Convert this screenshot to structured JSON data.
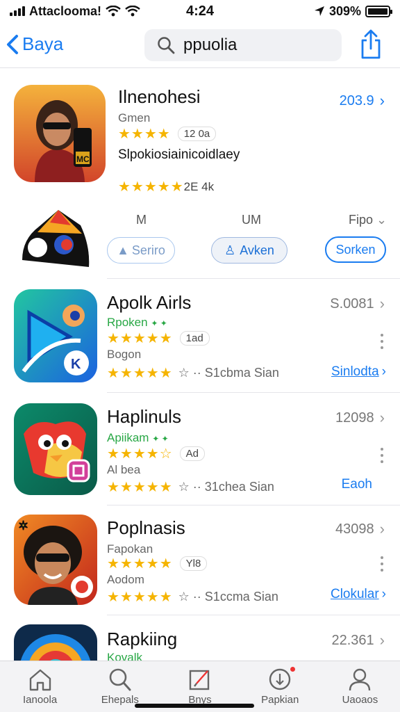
{
  "status_bar": {
    "carrier": "Attaclooma!",
    "time": "4:24",
    "battery": "309%"
  },
  "nav": {
    "back_label": "Baya",
    "search_value": "ppuolia"
  },
  "featured": {
    "title": "Ilnenohesi",
    "subtitle": "Gmen",
    "rating_count": "12 0a",
    "description": "Slpokiosiainicoidlaey",
    "review_count": "2E 4k",
    "price": "203.9",
    "icon_text": "MC"
  },
  "action_row": {
    "col1": "M",
    "col2": "UM",
    "col3": "Fipo",
    "button1": "Seriro",
    "button2": "Avken",
    "button3": "Sorken"
  },
  "apps": [
    {
      "title": "Apolk Airls",
      "subtitle": "Rpoken",
      "rating_pill": "1ad",
      "extra": "Bogon",
      "meta": "S1cbma Sian",
      "price": "S.0081",
      "link": "Sinlodta"
    },
    {
      "title": "Haplinuls",
      "subtitle": "Apiikam",
      "rating_pill": "Ad",
      "extra": "Al bea",
      "meta": "31chea Sian",
      "price": "12098",
      "link": "Eaoh"
    },
    {
      "title": "Poplnasis",
      "subtitle": "Fapokan",
      "rating_pill": "Yl8",
      "extra": "Aodom",
      "meta": "S1ccma Sian",
      "price": "43098",
      "link": "Clokular"
    },
    {
      "title": "Rapkiing",
      "subtitle": "Kovalk",
      "price": "22.361"
    }
  ],
  "tabs": [
    {
      "label": "Ianoola"
    },
    {
      "label": "Ehepals"
    },
    {
      "label": "Bnys"
    },
    {
      "label": "Papkian"
    },
    {
      "label": "Uaoaos"
    }
  ],
  "colors": {
    "accent": "#1a7cf0",
    "star": "#f5b400",
    "green": "#28a745"
  }
}
